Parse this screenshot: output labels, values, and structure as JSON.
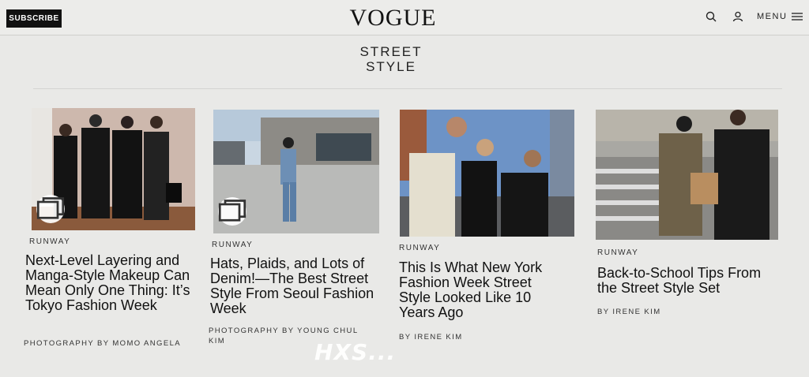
{
  "header": {
    "subscribe_label": "SUBSCRIBE",
    "logo": "VOGUE",
    "menu_label": "MENU"
  },
  "section": {
    "title_line1": "STREET",
    "title_line2": "STYLE"
  },
  "articles": [
    {
      "kicker": "RUNWAY",
      "headline": "Next-Level Layering and Manga-Style Makeup Can Mean Only One Thing: It’s Tokyo Fashion Week",
      "byline": "PHOTOGRAPHY BY MOMO ANGELA",
      "has_gallery_icon": true
    },
    {
      "kicker": "RUNWAY",
      "headline": "Hats, Plaids, and Lots of Denim!—The Best Street Style From Seoul Fashion Week",
      "byline": "PHOTOGRAPHY BY YOUNG CHUL KIM",
      "has_gallery_icon": true
    },
    {
      "kicker": "RUNWAY",
      "headline": "This Is What New York Fashion Week Street Style Looked Like 10 Years Ago",
      "byline": "BY IRENE KIM",
      "has_gallery_icon": false
    },
    {
      "kicker": "RUNWAY",
      "headline": "Back-to-School Tips From the Street Style Set",
      "byline": "BY IRENE KIM",
      "has_gallery_icon": false
    }
  ],
  "overlay": {
    "watermark": "HXS..."
  },
  "icons": [
    "search-icon",
    "user-icon",
    "hamburger-icon",
    "gallery-icon"
  ],
  "colors": {
    "background": "#e9e9e7",
    "subscribe_bg": "#111111",
    "text": "#111111"
  }
}
